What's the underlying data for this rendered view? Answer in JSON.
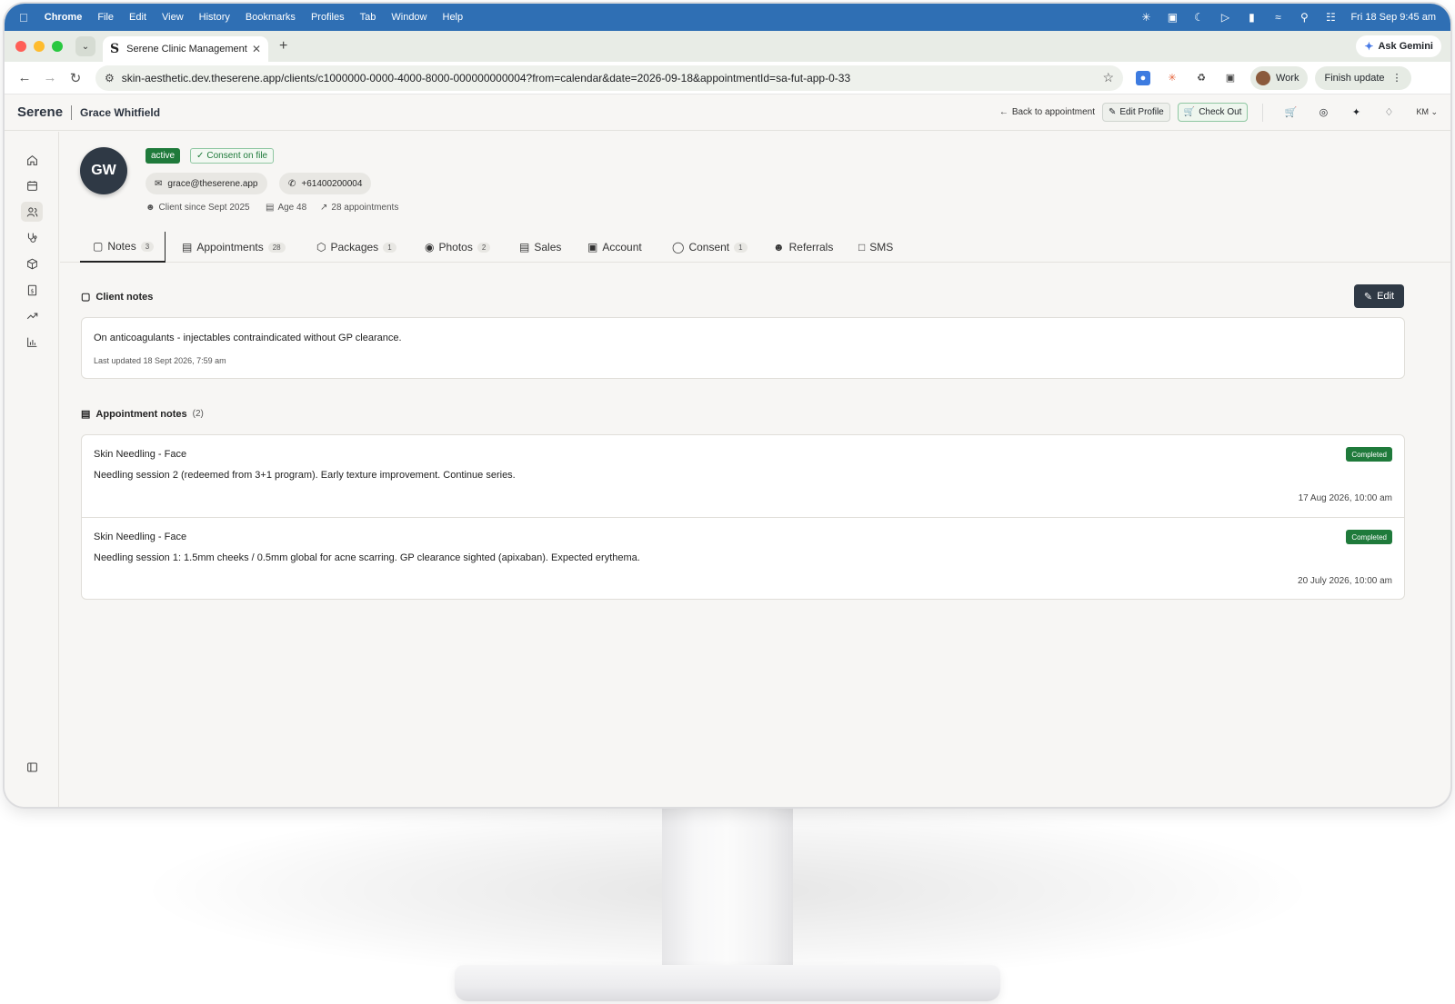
{
  "menubar": {
    "app": "Chrome",
    "items": [
      "File",
      "Edit",
      "View",
      "History",
      "Bookmarks",
      "Profiles",
      "Tab",
      "Window",
      "Help"
    ],
    "clock": "Fri 18 Sep  9:45 am"
  },
  "browser": {
    "tab_title": "Serene Clinic Management",
    "tab_favicon": "S",
    "ask_gemini": "Ask Gemini",
    "url": "skin-aesthetic.dev.theserene.app/clients/c1000000-0000-4000-8000-000000000004?from=calendar&date=2026-09-18&appointmentId=sa-fut-app-0-33",
    "profile": "Work",
    "finish_update": "Finish update"
  },
  "header": {
    "brand": "Serene",
    "client_name": "Grace Whitfield",
    "back_label": "Back to appointment",
    "edit_profile": "Edit Profile",
    "check_out": "Check Out",
    "user_initials": "KM"
  },
  "client": {
    "initials": "GW",
    "status": "active",
    "consent": "Consent on file",
    "email": "grace@theserene.app",
    "phone": "+61400200004",
    "client_since": "Client since Sept 2025",
    "age": "Age 48",
    "appointments": "28 appointments"
  },
  "tabs": [
    {
      "label": "Notes",
      "count": "3"
    },
    {
      "label": "Appointments",
      "count": "28"
    },
    {
      "label": "Packages",
      "count": "1"
    },
    {
      "label": "Photos",
      "count": "2"
    },
    {
      "label": "Sales",
      "count": ""
    },
    {
      "label": "Account",
      "count": ""
    },
    {
      "label": "Consent",
      "count": "1"
    },
    {
      "label": "Referrals",
      "count": ""
    },
    {
      "label": "SMS",
      "count": ""
    }
  ],
  "client_notes": {
    "title": "Client notes",
    "edit_label": "Edit",
    "text": "On anticoagulants - injectables contraindicated without GP clearance.",
    "updated": "Last updated 18 Sept 2026, 7:59 am"
  },
  "appointment_notes": {
    "title": "Appointment notes",
    "count": "(2)",
    "items": [
      {
        "title": "Skin Needling - Face",
        "status": "Completed",
        "text": "Needling session 2 (redeemed from 3+1 program). Early texture improvement. Continue series.",
        "when": "17 Aug 2026, 10:00 am"
      },
      {
        "title": "Skin Needling - Face",
        "status": "Completed",
        "text": "Needling session 1: 1.5mm cheeks / 0.5mm global for acne scarring. GP clearance sighted (apixaban). Expected erythema.",
        "when": "20 July 2026, 10:00 am"
      }
    ]
  },
  "colors": {
    "accent_dark": "#2f3945",
    "success": "#1f7a3b",
    "menubar": "#2f6fb4"
  }
}
